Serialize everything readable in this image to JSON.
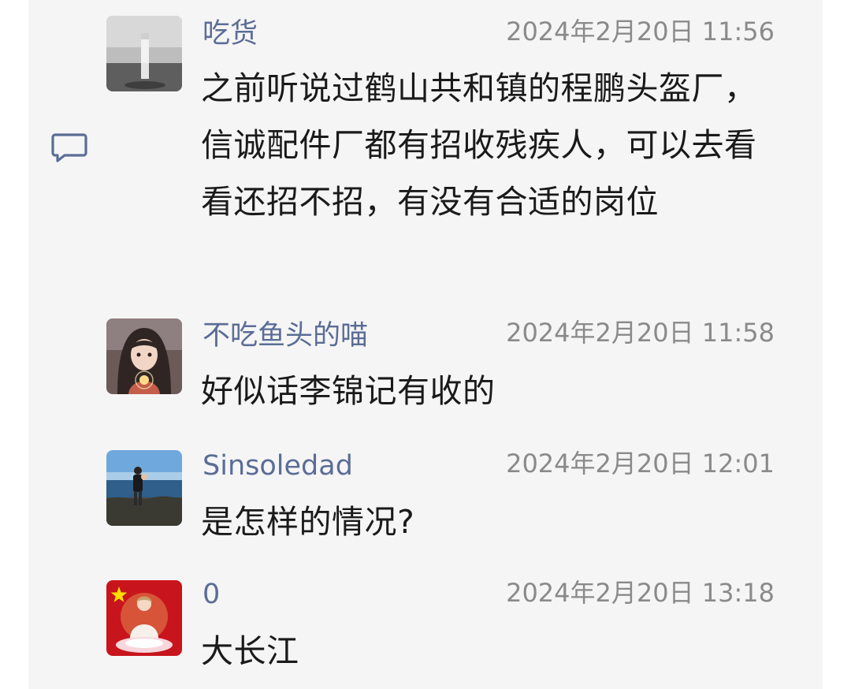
{
  "comments": [
    {
      "author": "吃货",
      "time": "2024年2月20日 11:56",
      "text": "之前听说过鹤山共和镇的程鹏头盔厂，信诚配件厂都有招收残疾人，可以去看看还招不招，有没有合适的岗位",
      "avatar": "cigarette-photo-avatar"
    },
    {
      "author": "不吃鱼头的喵",
      "time": "2024年2月20日 11:58",
      "text": "好似话李锦记有收的",
      "avatar": "girl-illustration-avatar"
    },
    {
      "author": "Sinsoledad",
      "time": "2024年2月20日 12:01",
      "text": "是怎样的情况?",
      "avatar": "seaside-photo-avatar"
    },
    {
      "author": "0",
      "time": "2024年2月20日 13:18",
      "text": "大长江",
      "avatar": "flag-meditation-avatar"
    }
  ],
  "icons": {
    "comment": "comment-icon"
  },
  "colors": {
    "author": "#5b6d96",
    "timestamp": "#8a8a8a",
    "body_text": "#1a1a1a",
    "panel_background": "#f5f5f5"
  }
}
